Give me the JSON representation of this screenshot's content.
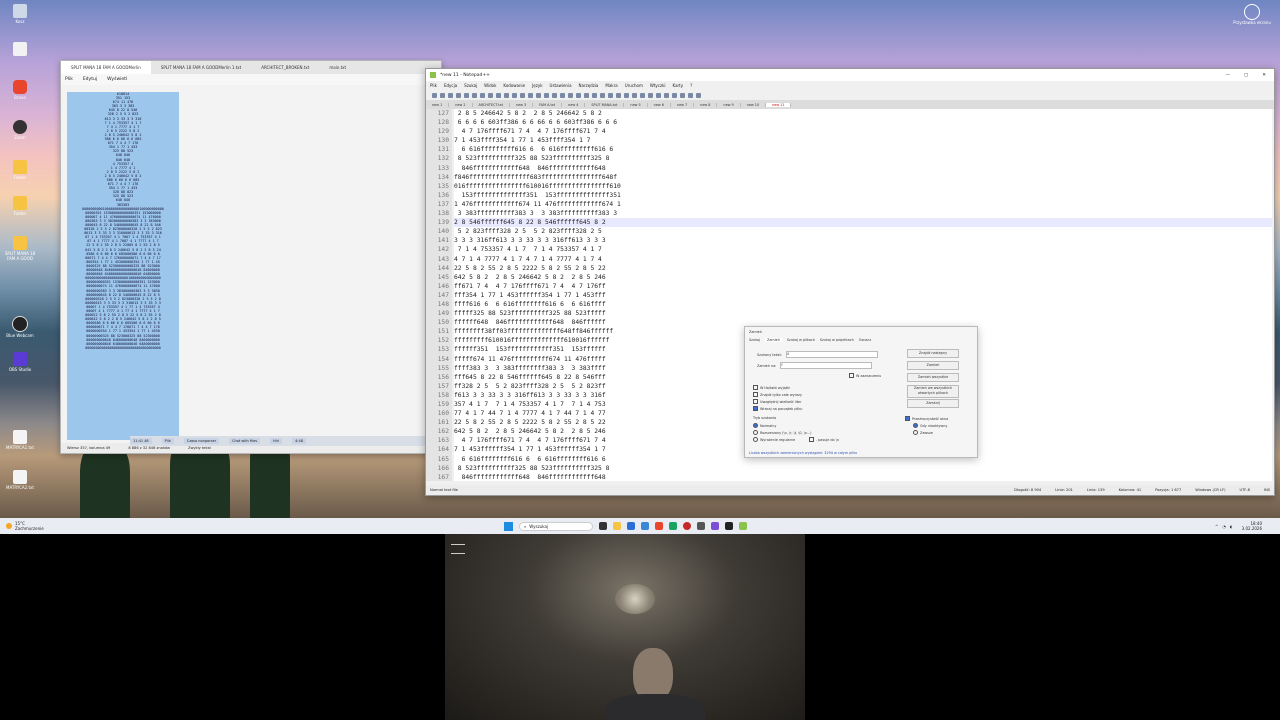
{
  "desktop": {
    "icons": [
      "Kosz",
      "",
      "Brave",
      "Zoom",
      "Folder",
      "Folder",
      "SPLIT MANA 18 FAM A GOOD",
      "Blue Webcam",
      "OBS Studio",
      "MATRYCA1.txt",
      "MATRYCA2.txt"
    ],
    "right_icon_label": "Przystawka ekranu"
  },
  "np_left": {
    "tabs": [
      "SPLIT MANA 18 FAM A GOODMerlin",
      "SPLIT MANA 18 FAM A GOODMerlin 1.txt",
      "ARCHITECT_BROKEN.txt",
      "main.txt"
    ],
    "menu": [
      "Plik",
      "Edytuj",
      "Wyświetl"
    ],
    "text": "618814\n351 153\n674 11 476\n383 3 3 383\n645 8 22 8 546\n328 2 5 5 2 823\n613 3 3 33 3 3 316\n7 1 4 753357 4 1 7\n7 4 1 7777 4 1 7\n2 8 5 2222 5 8 2\n2 8 5 246642 5 8 2\n586 6 6 66 6 6 685\n671 7 4 4 7 176\n354 1 77 1 453\n325 88 523\n648 846\n846 648\n4 753357 4\n1 4 7777 4 1\n2 8 5 2222 5 8 2\n2 8 5 246642 5 8 2\n586 6 66 6 6 685\n671 7 4 4 7 176\n354 1 77 1 453\n328 88 823\n325 88 523\n648 846\n383383\n0000000000100000000000000000100000000000\n00000351 153000000000000351 153000000\n000067 4 11 476000000000674 11 476000\n000383 3 3 383000000000383 3 3 383000\n000645 8 22 8 546000000645 8 22 8 546\n00328 2 5 5 2 823000000328 2 5 5 2 823\n0613 3 3 33 3 3 316000613 3 3 33 3 316\n07 1 4 753357 4 1 7007 1 4 753357 4 1\n07 4 1 7777 4 1 7007 4 1 7777 4 1 7\n22 5 8 2 55 2 8 5 22005 8 2 55 2 8 5\n642 5 8 2 2 8 5 246642 5 8 2 2 8 5 24\n0586 6 6 66 6 6 685000586 6 6 66 6 6\n00671 7 4 4 7 176000000671 7 4 4 7 17\n000354 1 77 1 453000000354 1 77 1 45\n0000325 88 523000000000325 88 523000\n00000648 846000000000000648 84600000\n00000846 648000000000000846 64800000\n0000000000000000000001000000000000000\n000000000351 1530000000000351 153000\n0000000674 11 4760000000674 11 47600\n0000000383 3 3 383000000383 3 3 3830\n0000000645 8 22 8 546000645 8 22 8 5\n000000328 2 5 5 2 823000328 2 5 5 2 8\n00000613 3 3 33 3 3 316613 3 3 33 3 3\n00007 1 4 753357 4 1 77 1 4 753357 4\n00007 4 1 7777 4 1 77 4 1 7777 4 1 7\n000022 5 8 2 55 2 8 5 22 5 8 2 55 2 8\n000642 5 8 2 2 8 5 246642 5 8 2 2 8 5\n0000586 6 6 66 6 6 685586 6 6 66 6 6\n000000671 7 4 4 7 176671 7 4 4 7 176\n0000000354 1 77 1 453354 1 77 1 4530\n00000000325 88 523000325 88 52300000\n000000000648 846000000648 8460000000\n000000000846 648000000846 6480000000\n0000000000000000000000000000000000000",
    "status": [
      "Wiersz 357, kolumna 49",
      "8 886 z 32 846 znaków",
      "Zwykły tekst"
    ]
  },
  "mini_strip": [
    "11:41 48",
    "Plik",
    "Czaso nonparser",
    "Chat with files",
    "Hiri",
    "4:48"
  ],
  "npp": {
    "title": "*new 11 - Notepad++",
    "window_controls": [
      "—",
      "▢",
      "✕"
    ],
    "menu": [
      "Plik",
      "Edycja",
      "Szukaj",
      "Widok",
      "Kodowanie",
      "Język",
      "Ustawienia",
      "Narzędzia",
      "Makra",
      "Uruchom",
      "Wtyczki",
      "Karty",
      "?"
    ],
    "tabs": [
      "new 1",
      "new 2",
      "ARCHITECT.txt",
      "new 3",
      "FAM A.txt",
      "new 4",
      "SPLIT MANA.txt",
      "new 5",
      "new 6",
      "new 7",
      "new 8",
      "new 9",
      "new 10",
      "new 11"
    ],
    "active_tab": "new 11",
    "lines": [
      {
        "n": "127",
        "t": " 2 8 5 246642 5 8 2  2 8 5 246642 5 8 2"
      },
      {
        "n": "128",
        "t": " 6 6 6 6 603ff386 6 6 66 6 6 603ff386 6 6 6"
      },
      {
        "n": "129",
        "t": "  4 7 176ffff671 7 4  4 7 176ffff671 7 4"
      },
      {
        "n": "130",
        "t": "7 1 453ffff354 1 77 1 453ffff354 1 7"
      },
      {
        "n": "131",
        "t": "  6 616fffffffff616 6  6 616fffffffff616 6"
      },
      {
        "n": "132",
        "t": " 8 523ffffffffff325 88 523ffffffffff325 8"
      },
      {
        "n": "133",
        "t": "  846ffffffffffff648  846ffffffffffff648"
      },
      {
        "n": "134",
        "t": "f846ffffffffffffffff683ffffffffffffffff648f"
      },
      {
        "n": "135",
        "t": "016ffffffffffffffff610016ffffffffffffffff610"
      },
      {
        "n": "136",
        "t": "  153ffffffffffffff351  153ffffffffffffff351"
      },
      {
        "n": "137",
        "t": "1 476ffffffffffff674 11 476ffffffffffff674 1"
      },
      {
        "n": "138",
        "t": " 3 383ffffffffff383 3  3 383ffffffffff383 3"
      },
      {
        "n": "139",
        "t": "2 8 546ffffff645 8 22 8 546ffffff645 8 2",
        "cur": true
      },
      {
        "n": "140",
        "t": " 5 2 823ffff328 2 5  5 2 823ffff328 2 5"
      },
      {
        "n": "141",
        "t": "3 3 3 316ff613 3 3 33 3 3 316ff613 3 3 3"
      },
      {
        "n": "142",
        "t": " 7 1 4 753357 4 1 7  7 1 4 753357 4 1 7"
      },
      {
        "n": "143",
        "t": "4 7 1 4 7777 4 1 7 4 7 1 4 7777 4 1 7 4"
      },
      {
        "n": "144",
        "t": "22 5 8 2 55 2 8 5 2222 5 8 2 55 2 8 5 22"
      },
      {
        "n": "145",
        "t": "642 5 8 2  2 8 5 246642 5 8 2  2 8 5 246"
      },
      {
        "n": "146",
        "t": "ff671 7 4  4 7 176ffff671 7 4  4 7 176ff"
      },
      {
        "n": "147",
        "t": "fff354 1 77 1 453ffffff354 1 77 1 453fff"
      },
      {
        "n": "148",
        "t": "ffff616 6  6 616ffffffff616 6  6 616ffff"
      },
      {
        "n": "149",
        "t": "fffff325 88 523ffffffffff325 88 523fffff"
      },
      {
        "n": "150",
        "t": "ffffff648  846ffffffffffff648  846ffffff"
      },
      {
        "n": "151",
        "t": "ffffffff38ff03ffffffffffffff648ff846ffffff"
      },
      {
        "n": "152",
        "t": "fffffffff610016ffffffffffffff610016ffffff"
      },
      {
        "n": "153",
        "t": "ffffff351  153ffffffffffff351  153ffffff"
      },
      {
        "n": "154",
        "t": "fffff674 11 476ffffffffff674 11 476fffff"
      },
      {
        "n": "155",
        "t": "ffff383 3  3 383ffffffff383 3  3 383ffff"
      },
      {
        "n": "156",
        "t": "fff645 8 22 8 546ffffff645 8 22 8 546fff"
      },
      {
        "n": "157",
        "t": "ff328 2 5  5 2 823ffff328 2 5  5 2 823ff"
      },
      {
        "n": "158",
        "t": "f613 3 3 33 3 3 316ff613 3 3 33 3 3 316f"
      },
      {
        "n": "159",
        "t": "357 4 1 7  7 1 4 753357 4 1 7  7 1 4 753"
      },
      {
        "n": "160",
        "t": "77 4 1 7 44 7 1 4 7777 4 1 7 44 7 1 4 77"
      },
      {
        "n": "161",
        "t": "22 5 8 2 55 2 8 5 2222 5 8 2 55 2 8 5 22"
      },
      {
        "n": "162",
        "t": "642 5 8 2  2 8 5 246642 5 8 2  2 8 5 246"
      },
      {
        "n": "163",
        "t": "  4 7 176ffff671 7 4  4 7 176ffff671 7 4"
      },
      {
        "n": "164",
        "t": "7 1 453ffffff354 1 77 1 453ffffff354 1 7"
      },
      {
        "n": "165",
        "t": "  6 616ffffffff616 6  6 616ffffffff616 6"
      },
      {
        "n": "166",
        "t": " 8 523ffffffffff325 88 523ffffffffff325 8"
      },
      {
        "n": "167",
        "t": "  846ffffffffffff648  846ffffffffffff648"
      },
      {
        "n": "168",
        "t": "f838ffffffffffffffff38ff03ffffffffffffff38f"
      }
    ],
    "status_left": "Normal text file",
    "status_right": [
      "Długość: 8 904",
      "Linie: 201",
      "Linia: 139",
      "Kolumna: 41",
      "Pozycja: 1 677",
      "Windows (CR LF)",
      "UTF-8",
      "INS"
    ]
  },
  "find_dialog": {
    "title": "Zamień",
    "tabs": [
      "Szukaj",
      "Zamień",
      "Szukaj w plikach",
      "Szukaj w projektach",
      "Oznacz"
    ],
    "active_tab": "Zamień",
    "find_label": "Szukany tekst:",
    "find_value": "4",
    "replace_label": "Zamień na:",
    "replace_value": "f",
    "selection_label": "W zaznaczeniu",
    "buttons": [
      "Znajdź następny",
      "Zamień",
      "Zamień wszystkie",
      "Zamień we wszystkich otwartych plikach",
      "Zamknij"
    ],
    "checks": [
      "W tła/tabt wyjątki",
      "Znajdź tylko całe wyrazy",
      "Uwzględnij wielkość liter",
      "Wracaj na początek pliku"
    ],
    "mode_label": "Tryb szukania",
    "modes": [
      "Normalny",
      "Rozszerzony (\\n, \\r, \\t, \\0, \\x...)",
      "Wyrażenie regularne"
    ],
    "dot_label": ". pasuje do \\n",
    "transparency_label": "Przeźroczystość okna",
    "transparency_opts": [
      "Gdy nieaktywny",
      "Zawsze"
    ],
    "footer": "Liczba wszystkich zamienionych wystąpień: 3294 w całym pliku"
  },
  "taskbar": {
    "weather_temp": "15°C",
    "weather_desc": "Zachmurzenie",
    "search_placeholder": "Wyszukaj",
    "time": "18:40",
    "date": "3.02.2026"
  }
}
